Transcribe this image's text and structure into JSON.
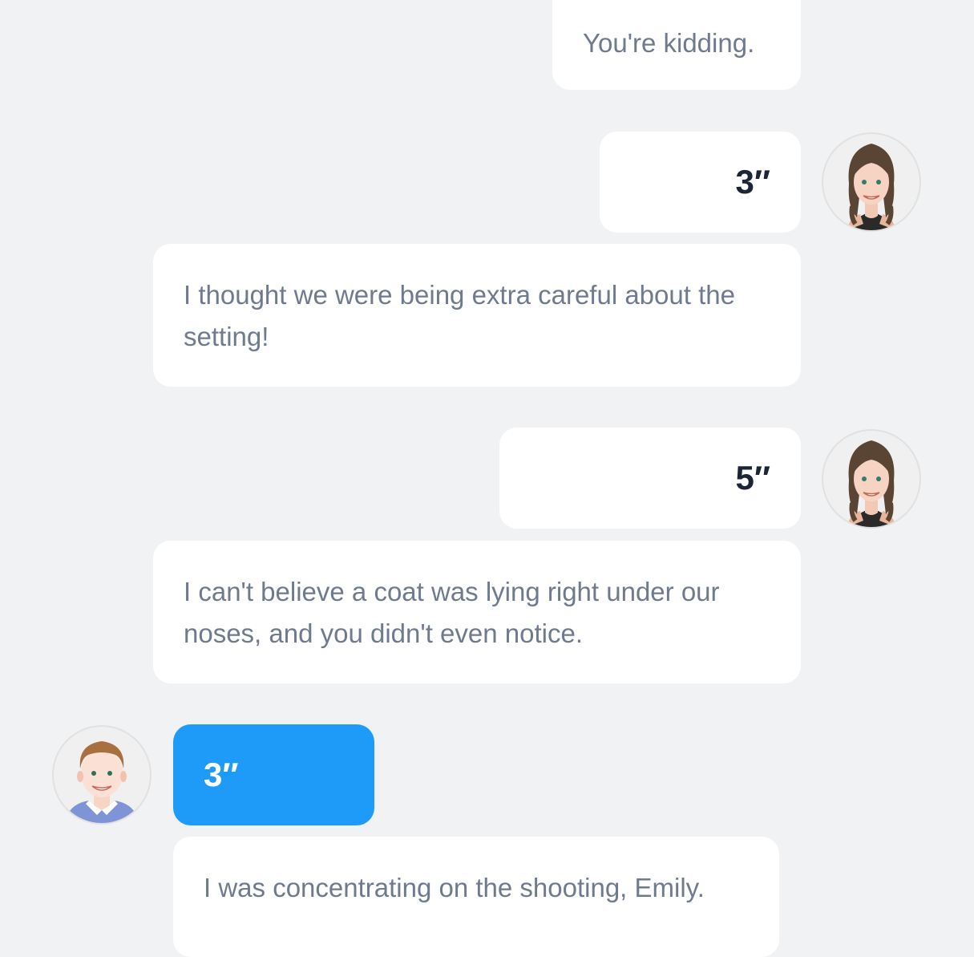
{
  "chat": {
    "messages": [
      {
        "id": "m1",
        "side": "right",
        "type": "text",
        "text": "You're kidding."
      },
      {
        "id": "m2",
        "side": "right",
        "type": "voice",
        "duration": "3″",
        "avatar": "woman-avatar"
      },
      {
        "id": "m3",
        "side": "right",
        "type": "text",
        "text": "I thought we were being extra careful about the setting!"
      },
      {
        "id": "m4",
        "side": "right",
        "type": "voice",
        "duration": "5″",
        "avatar": "woman-avatar"
      },
      {
        "id": "m5",
        "side": "right",
        "type": "text",
        "text": "I can't believe a coat was lying right under our noses, and you didn't even notice."
      },
      {
        "id": "m6",
        "side": "left",
        "type": "voice",
        "duration": "3″",
        "avatar": "man-avatar"
      },
      {
        "id": "m7",
        "side": "left",
        "type": "text",
        "text": "I was concentrating on the shooting, Emily."
      }
    ]
  },
  "colors": {
    "background": "#f1f2f4",
    "bubble": "#ffffff",
    "text": "#6f7a8f",
    "voice_text": "#1b2536",
    "accent_blue": "#1e9bf9"
  }
}
